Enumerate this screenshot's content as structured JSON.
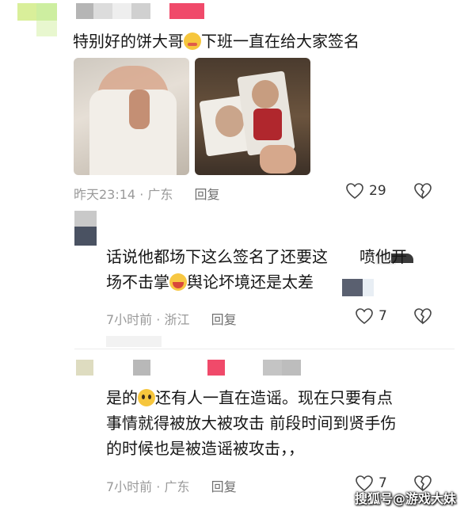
{
  "comments": [
    {
      "text_lines": [
        "特别好的饼大哥",
        "下班一直在给大家签名"
      ],
      "time": "昨天23:14",
      "location": "广东",
      "reply_label": "回复",
      "likes": "29"
    },
    {
      "text_lines": [
        "话说他都场下这么签名了还要这",
        "喷他开",
        "场不击掌",
        "舆论坏境还是太差"
      ],
      "time": "7小时前",
      "location": "浙江",
      "reply_label": "回复",
      "likes": "7"
    },
    {
      "text_lines": [
        "是的",
        "还有人一直在造谣。现在只要有点",
        "事情就得被放大被攻击 前段时间到贤手伤",
        "的时候也是被造谣被攻击，，"
      ],
      "time": "7小时前",
      "location": "广东",
      "reply_label": "回复",
      "likes": "7"
    }
  ],
  "meta_separator": "·",
  "watermark": "搜狐号@游戏大妹",
  "colors": {
    "accent_pink": "#f04a6a",
    "meta_gray": "#9a9a9a"
  },
  "icons": [
    "emoji-blush-icon",
    "emoji-cry-icon",
    "emoji-plead-icon",
    "heart-icon",
    "broken-heart-icon"
  ]
}
